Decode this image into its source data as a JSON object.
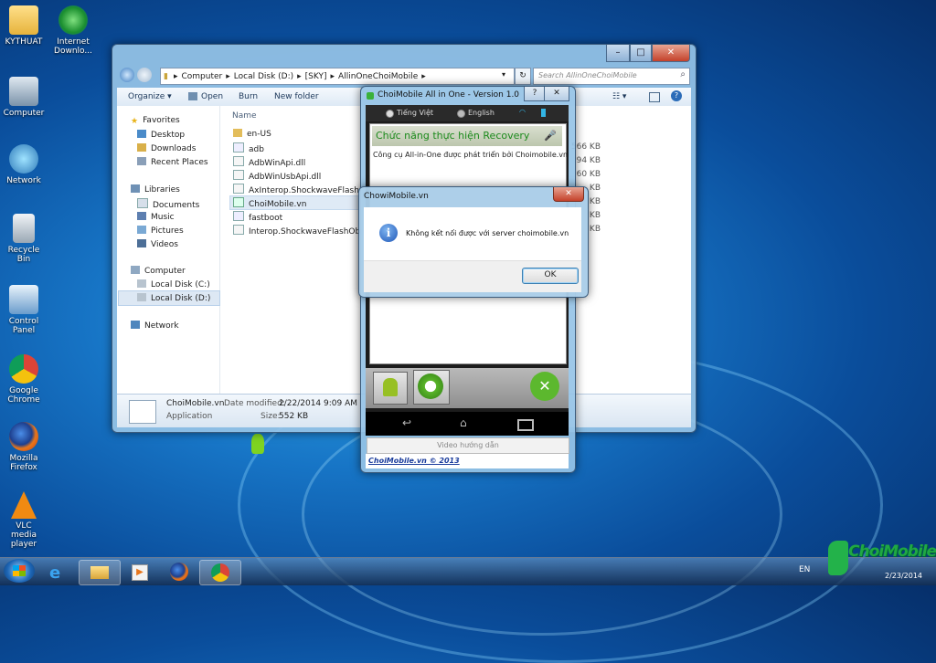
{
  "desktop": {
    "icons": [
      {
        "label": "KYTHUAT"
      },
      {
        "label": "Internet Downlo..."
      },
      {
        "label": "Computer"
      },
      {
        "label": "Network"
      },
      {
        "label": "Recycle Bin"
      },
      {
        "label": "Control Panel"
      },
      {
        "label": "Google Chrome"
      },
      {
        "label": "Mozilla Firefox"
      },
      {
        "label": "VLC media player"
      }
    ]
  },
  "explorer": {
    "breadcrumb": [
      "Computer",
      "Local Disk (D:)",
      "[SKY]",
      "AllinOneChoiMobile"
    ],
    "search_placeholder": "Search AllinOneChoiMobile",
    "toolbar": {
      "organize": "Organize ▾",
      "open": "Open",
      "burn": "Burn",
      "new_folder": "New folder"
    },
    "nav": {
      "favorites": "Favorites",
      "desktop": "Desktop",
      "downloads": "Downloads",
      "recent": "Recent Places",
      "libraries": "Libraries",
      "documents": "Documents",
      "music": "Music",
      "pictures": "Pictures",
      "videos": "Videos",
      "computer": "Computer",
      "disk_c": "Local Disk (C:)",
      "disk_d": "Local Disk (D:)",
      "network": "Network"
    },
    "column_name": "Name",
    "files": [
      {
        "name": "en-US",
        "size": ""
      },
      {
        "name": "adb",
        "size": "566 KB"
      },
      {
        "name": "AdbWinApi.dll",
        "size": "94 KB"
      },
      {
        "name": "AdbWinUsbApi.dll",
        "size": "60 KB"
      },
      {
        "name": "AxInterop.ShockwaveFlashObject...",
        "size": "KB"
      },
      {
        "name": "ChoiMobile.vn",
        "size": "KB"
      },
      {
        "name": "fastboot",
        "size": "KB"
      },
      {
        "name": "Interop.ShockwaveFlashObjects....",
        "size": "KB"
      }
    ],
    "details": {
      "name": "ChoiMobile.vn",
      "type": "Application",
      "modified_label": "Date modified:",
      "modified": "2/22/2014 9:09 AM",
      "size_label": "Size:",
      "size": "552 KB"
    }
  },
  "choimobile": {
    "title": "ChoiMobile All in One - Version 1.0",
    "help": "?",
    "lang_vi": "Tiếng Việt",
    "lang_en": "English",
    "function_title": "Chức năng thực hiện Recovery",
    "desc": "Công cụ All-in-One được phát triển bởi Choimobile.vn",
    "video_guide": "Video hướng dẫn",
    "footer": "ChoiMobile.vn © 2013"
  },
  "dialog": {
    "title": "ChowiMobile.vn",
    "message": "Không kết nối được với server choimobile.vn",
    "ok": "OK"
  },
  "taskbar": {
    "lang": "EN",
    "date": "2/23/2014"
  },
  "watermark": {
    "text": "ChoiMobile"
  }
}
